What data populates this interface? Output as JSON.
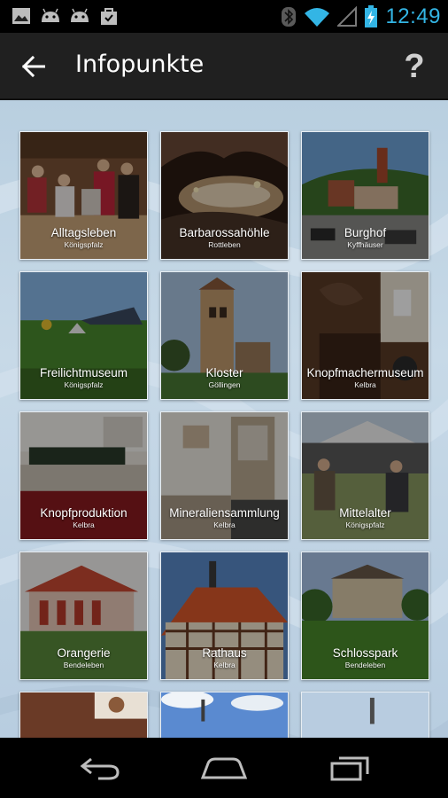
{
  "status_bar": {
    "time": "12:49",
    "icons": [
      "gallery-icon",
      "android-icon",
      "android-icon",
      "shopping-bag-icon",
      "bluetooth-icon",
      "wifi-icon",
      "signal-icon",
      "battery-charging-icon"
    ]
  },
  "action_bar": {
    "title": "Infopunkte",
    "back_icon": "arrow-left-icon",
    "help_label": "?"
  },
  "tiles": [
    {
      "title": "Alltagsleben",
      "subtitle": "Königspfalz"
    },
    {
      "title": "Barbarossahöhle",
      "subtitle": "Rottleben"
    },
    {
      "title": "Burghof",
      "subtitle": "Kyffhäuser"
    },
    {
      "title": "Freilichtmuseum",
      "subtitle": "Königspfalz"
    },
    {
      "title": "Kloster",
      "subtitle": "Göllingen"
    },
    {
      "title": "Knopfmachermuseum",
      "subtitle": "Kelbra"
    },
    {
      "title": "Knopfproduktion",
      "subtitle": "Kelbra"
    },
    {
      "title": "Mineraliensammlung",
      "subtitle": "Kelbra"
    },
    {
      "title": "Mittelalter",
      "subtitle": "Königspfalz"
    },
    {
      "title": "Orangerie",
      "subtitle": "Bendeleben"
    },
    {
      "title": "Rathaus",
      "subtitle": "Kelbra"
    },
    {
      "title": "Schlosspark",
      "subtitle": "Bendeleben"
    }
  ],
  "nav_bar": {
    "icons": [
      "back-nav-icon",
      "home-nav-icon",
      "recent-apps-icon"
    ]
  }
}
